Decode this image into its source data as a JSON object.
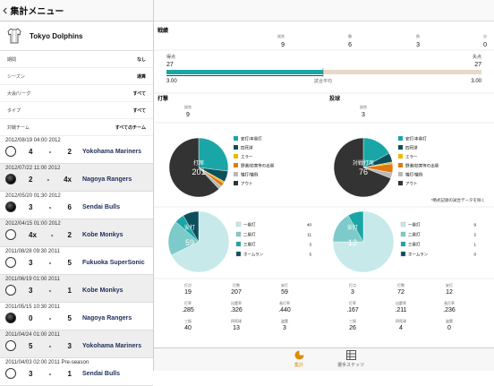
{
  "header": {
    "title": "集計メニュー"
  },
  "team": {
    "name": "Tokyo Dolphins"
  },
  "filters": [
    {
      "label": "期間",
      "value": "なし"
    },
    {
      "label": "シーズン",
      "value": "通算"
    },
    {
      "label": "大会/リーグ",
      "value": "すべて"
    },
    {
      "label": "タイプ",
      "value": "すべて"
    },
    {
      "label": "対戦チーム",
      "value": "すべてのチーム"
    }
  ],
  "games": [
    {
      "date": "2012/08/19 04:00  2012",
      "ours": "4",
      "theirs": "2",
      "opponent": "Yokohama Mariners",
      "result": "lose"
    },
    {
      "date": "2012/07/22 11:00  2012",
      "ours": "2",
      "theirs": "4x",
      "opponent": "Nagoya Rangers",
      "result": "win"
    },
    {
      "date": "2012/05/20 01:30  2012",
      "ours": "3",
      "theirs": "6",
      "opponent": "Sendai Bulls",
      "result": "win"
    },
    {
      "date": "2012/04/15 01:00  2012",
      "ours": "4x",
      "theirs": "2",
      "opponent": "Kobe Monkys",
      "result": "lose"
    },
    {
      "date": "2011/08/28 09:30  2011",
      "ours": "3",
      "theirs": "5",
      "opponent": "Fukuoka SuperSonic",
      "result": "lose"
    },
    {
      "date": "2011/06/19 01:00  2011",
      "ours": "3",
      "theirs": "1",
      "opponent": "Kobe Monkys",
      "result": "lose"
    },
    {
      "date": "2011/05/15 10:30  2011",
      "ours": "0",
      "theirs": "5",
      "opponent": "Nagoya Rangers",
      "result": "win"
    },
    {
      "date": "2011/04/24 01:00  2011",
      "ours": "5",
      "theirs": "3",
      "opponent": "Yokohama Mariners",
      "result": "lose"
    },
    {
      "date": "2011/04/03 02:00  2011 Pre-season",
      "ours": "3",
      "theirs": "1",
      "opponent": "Sendai Bulls",
      "result": "lose"
    }
  ],
  "record": {
    "title": "戦績",
    "cols": [
      {
        "label": "試合",
        "value": "9"
      },
      {
        "label": "勝",
        "value": "6"
      },
      {
        "label": "負",
        "value": "3"
      },
      {
        "label": "分",
        "value": "0"
      }
    ],
    "runs_label": "得点",
    "runs_total": "27",
    "allowed_label": "失点",
    "allowed_total": "27",
    "avg_label": "試合平均",
    "runs_avg": "3.00",
    "allowed_avg": "3.00"
  },
  "batting": {
    "title": "打撃",
    "games_label": "試合",
    "games": "9",
    "pie_label": "打席",
    "pie_value": "201",
    "hit_label": "安打",
    "hit_value": "59"
  },
  "pitching": {
    "title": "投球",
    "games_label": "試合",
    "games": "3",
    "pie_label": "対戦打席",
    "pie_value": "76",
    "hit_label": "安打",
    "hit_value": "12"
  },
  "legend_outcomes": [
    "安打/本塁打",
    "四死球",
    "エラー",
    "野選/妨害等の出塁",
    "犠打/犠飛",
    "アウト"
  ],
  "legend_hits": [
    "一塁打",
    "二塁打",
    "三塁打",
    "ホームラン"
  ],
  "bat_hits": [
    "40",
    "11",
    "3",
    "5"
  ],
  "pit_hits": [
    "9",
    "2",
    "1",
    "0"
  ],
  "note": "*略式記録の試合データを除く",
  "colors": {
    "hit": "#1aa6a6",
    "walk": "#0e4f5c",
    "error": "#f0b400",
    "fc": "#e07a10",
    "sac": "#b9b9b9",
    "out": "#333333"
  },
  "bat_stats": [
    {
      "label": "打点",
      "value": "19"
    },
    {
      "label": "打数",
      "value": "207"
    },
    {
      "label": "安打",
      "value": "59"
    },
    {
      "label": "打率",
      "value": ".285"
    },
    {
      "label": "出塁率",
      "value": ".326"
    },
    {
      "label": "長打率",
      "value": ".440"
    },
    {
      "label": "三振",
      "value": "40"
    },
    {
      "label": "四死球",
      "value": "13"
    },
    {
      "label": "盗塁",
      "value": "3"
    }
  ],
  "pit_stats": [
    {
      "label": "打点",
      "value": "3"
    },
    {
      "label": "打数",
      "value": "72"
    },
    {
      "label": "安打",
      "value": "12"
    },
    {
      "label": "打率",
      "value": ".167"
    },
    {
      "label": "出塁率",
      "value": ".211"
    },
    {
      "label": "長打率",
      "value": ".236"
    },
    {
      "label": "三振",
      "value": "26"
    },
    {
      "label": "四死球",
      "value": "4"
    },
    {
      "label": "盗塁",
      "value": "0"
    }
  ],
  "tabs": [
    {
      "label": "集計"
    },
    {
      "label": "選手ステッツ"
    }
  ]
}
